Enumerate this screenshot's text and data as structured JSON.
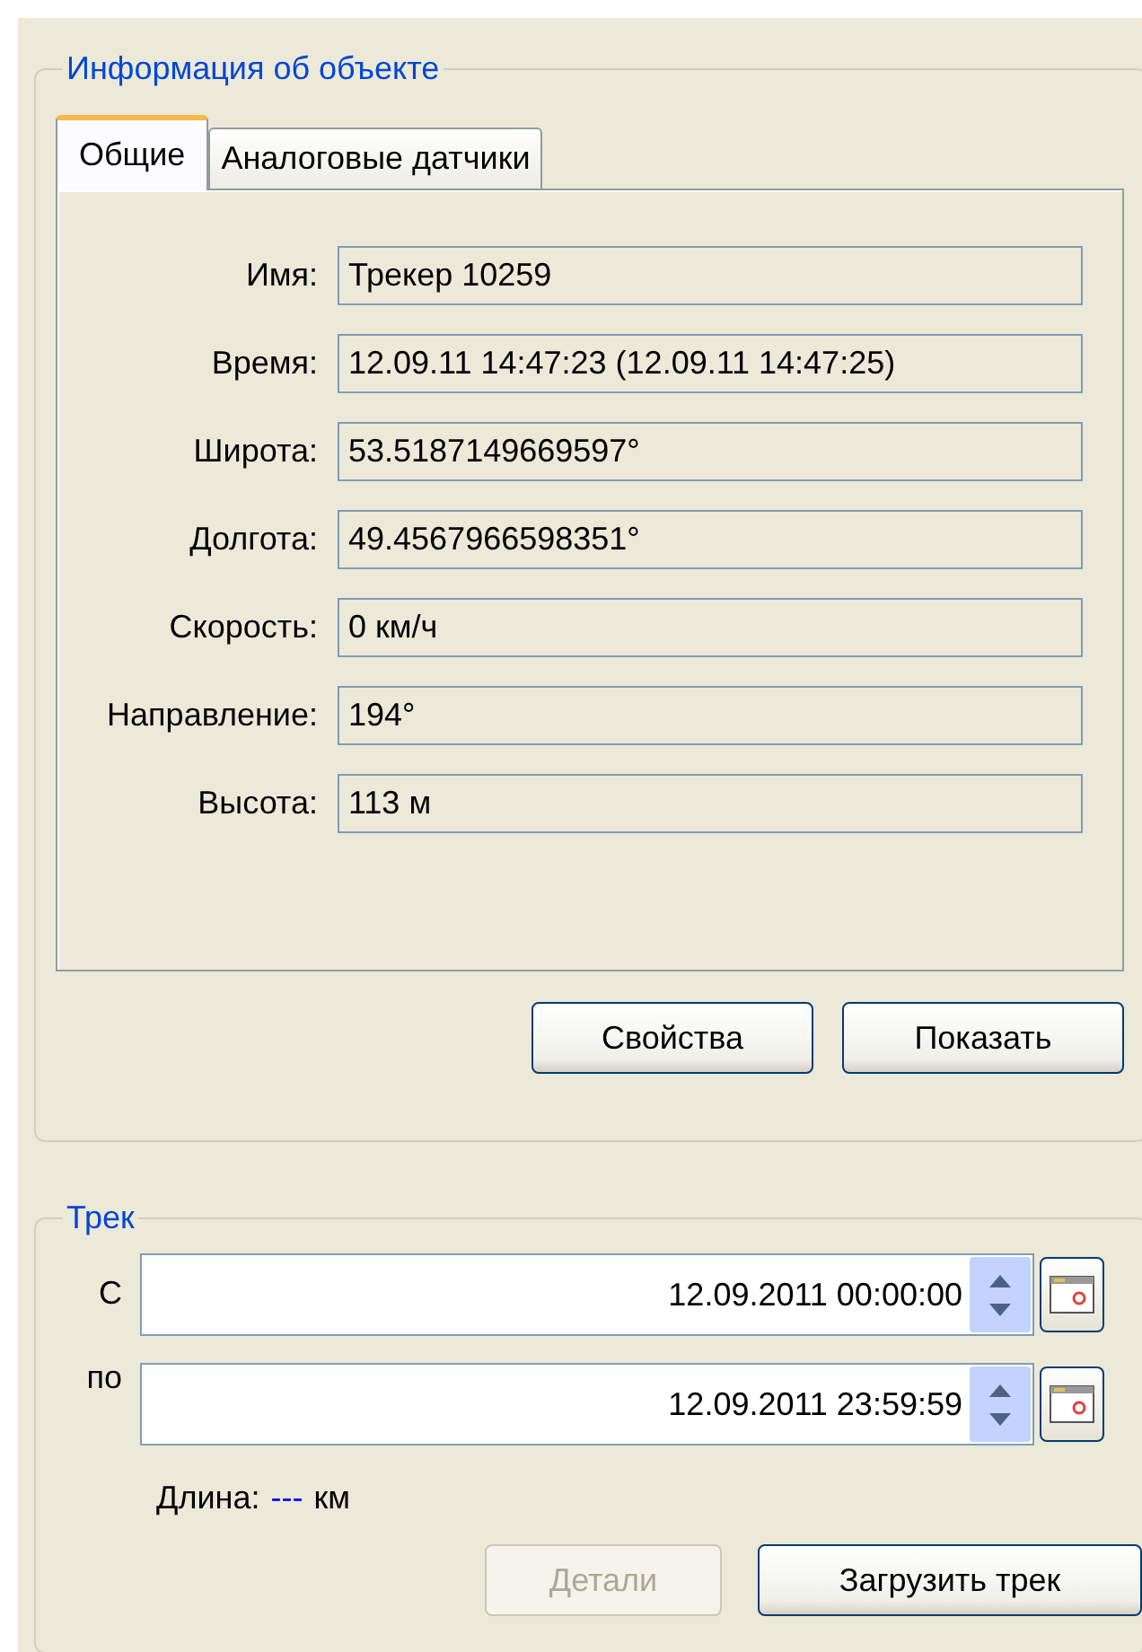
{
  "object_info": {
    "title": "Информация об объекте",
    "tabs": [
      {
        "label": "Общие",
        "selected": true
      },
      {
        "label": "Аналоговые датчики",
        "selected": false
      }
    ],
    "fields": [
      {
        "label": "Имя:",
        "value": "Трекер 10259"
      },
      {
        "label": "Время:",
        "value": "12.09.11 14:47:23 (12.09.11 14:47:25)"
      },
      {
        "label": "Широта:",
        "value": "53.5187149669597°"
      },
      {
        "label": "Долгота:",
        "value": "49.4567966598351°"
      },
      {
        "label": "Скорость:",
        "value": "0 км/ч"
      },
      {
        "label": "Направление:",
        "value": "194°"
      },
      {
        "label": "Высота:",
        "value": "113 м"
      }
    ],
    "buttons": [
      {
        "label": "Свойства",
        "disabled": false
      },
      {
        "label": "Показать",
        "disabled": false
      }
    ]
  },
  "track": {
    "title": "Трек",
    "ranges": [
      {
        "label": "С",
        "value": "12.09.2011 00:00:00"
      },
      {
        "label": "по",
        "value": "12.09.2011 23:59:59"
      }
    ],
    "length": {
      "label": "Длина:",
      "value": "---",
      "unit": "км"
    },
    "buttons": [
      {
        "label": "Детали",
        "disabled": true
      },
      {
        "label": "Загрузить трек",
        "disabled": false
      }
    ]
  }
}
